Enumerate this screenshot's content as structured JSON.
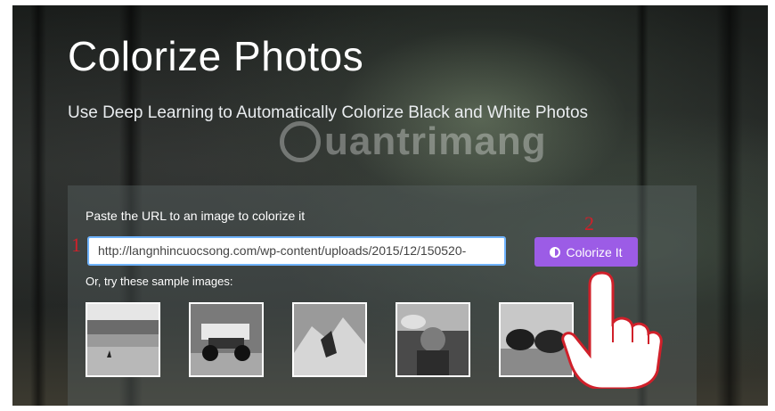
{
  "header": {
    "title": "Colorize Photos",
    "subtitle": "Use Deep Learning to Automatically Colorize Black and White Photos"
  },
  "watermark": {
    "text": "uantrimang"
  },
  "form": {
    "url_label": "Paste the URL to an image to colorize it",
    "url_value": "http://langnhincuocsong.com/wp-content/uploads/2015/12/150520-",
    "button_label": "Colorize It",
    "samples_label": "Or, try these sample images:"
  },
  "annotations": {
    "step1": "1",
    "step2": "2"
  },
  "samples": [
    {
      "name": "beach-birds"
    },
    {
      "name": "race-car"
    },
    {
      "name": "mountain-climber"
    },
    {
      "name": "smoking-man"
    },
    {
      "name": "cattle"
    }
  ],
  "colors": {
    "button": "#9c5ce6",
    "input_border": "#6fb3ff",
    "annotation": "#d0202a"
  }
}
